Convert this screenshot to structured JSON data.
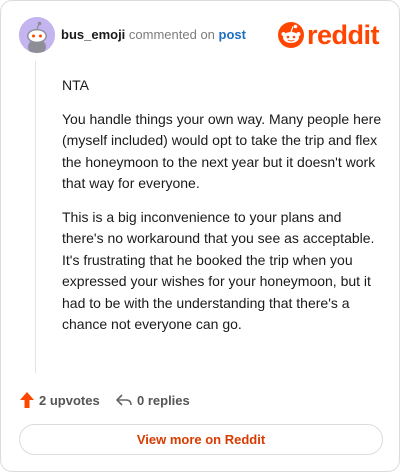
{
  "header": {
    "username": "bus_emoji",
    "verb": "commented on",
    "post_link": "post",
    "logo_text": "reddit"
  },
  "comment": {
    "paragraphs": [
      "NTA",
      "You handle things your own way. Many people here (myself included) would opt to take the trip and flex the honeymoon to the next year but it doesn't work that way for everyone.",
      "This is a big inconvenience to your plans and there's no workaround that you see as acceptable. It's frustrating that he booked the trip when you expressed your wishes for your honeymoon, but it had to be with the understanding that there's a chance not everyone can go."
    ]
  },
  "actions": {
    "upvotes_label": "2 upvotes",
    "replies_label": "0 replies"
  },
  "footer": {
    "view_more_label": "View more on Reddit"
  },
  "colors": {
    "brand": "#ff4500",
    "link": "#1f6ec4",
    "view_more": "#d93a00",
    "avatar_bg": "#c4b4ef"
  },
  "icons": {
    "avatar": "snoo-avatar-icon",
    "logo": "reddit-logo-icon",
    "upvote": "upvote-arrow-icon",
    "reply": "reply-arrow-icon"
  }
}
